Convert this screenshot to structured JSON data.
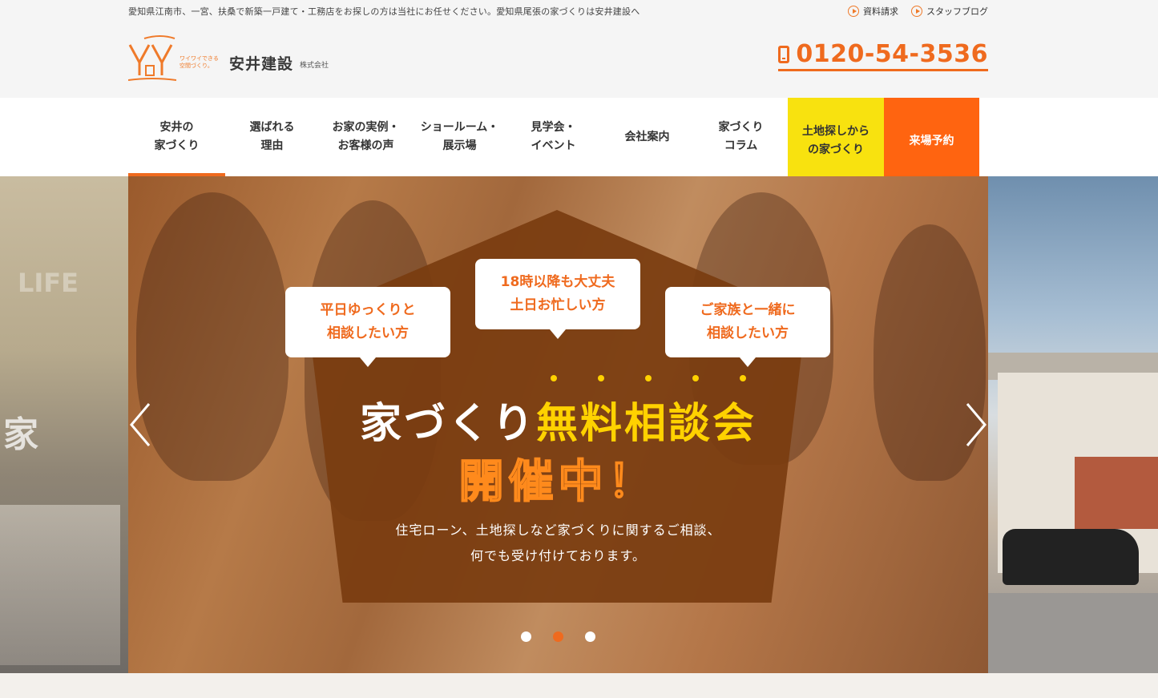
{
  "header": {
    "tagline": "愛知県江南市、一宮、扶桑で新築一戸建て・工務店をお探しの方は当社にお任せください。愛知県尾張の家づくりは安井建設へ",
    "links": [
      {
        "label": "資料請求",
        "icon": "play-circle-icon"
      },
      {
        "label": "スタッフブログ",
        "icon": "play-circle-icon"
      }
    ],
    "logo": {
      "mark": "YY",
      "sub_line1": "ワイワイできる",
      "sub_line2": "空間づくり。",
      "name": "安井建設",
      "corp": "株式会社"
    },
    "phone": "0120-54-3536"
  },
  "nav": {
    "items": [
      {
        "label": "安井の\n家づくり"
      },
      {
        "label": "選ばれる\n理由"
      },
      {
        "label": "お家の実例・\nお客様の声"
      },
      {
        "label": "ショールーム・\n展示場"
      },
      {
        "label": "見学会・\nイベント"
      },
      {
        "label": "会社案内"
      },
      {
        "label": "家づくり\nコラム"
      }
    ],
    "land": "土地探しから\nの家づくり",
    "visit": "来場予約"
  },
  "hero": {
    "bubbles": [
      "平日ゆっくりと\n相談したい方",
      "18時以降も大丈夫\n土日お忙しい方",
      "ご家族と一緒に\n相談したい方"
    ],
    "headline_white": "家づくり",
    "headline_yellow": "無料相談会",
    "kaisai": "開催中！",
    "subtext": "住宅ローン、土地探しなど家づくりに関するご相談、\n何でも受け付けております。",
    "left_peek_text": "LIFE",
    "left_peek_kanji": "家",
    "active_slide": 2,
    "slide_count": 3,
    "colors": {
      "accent": "#ef6a1e",
      "yellow": "#ffd200",
      "brown": "#7a3c10",
      "land_btn": "#f8e20f",
      "visit_btn": "#ff6410"
    }
  }
}
